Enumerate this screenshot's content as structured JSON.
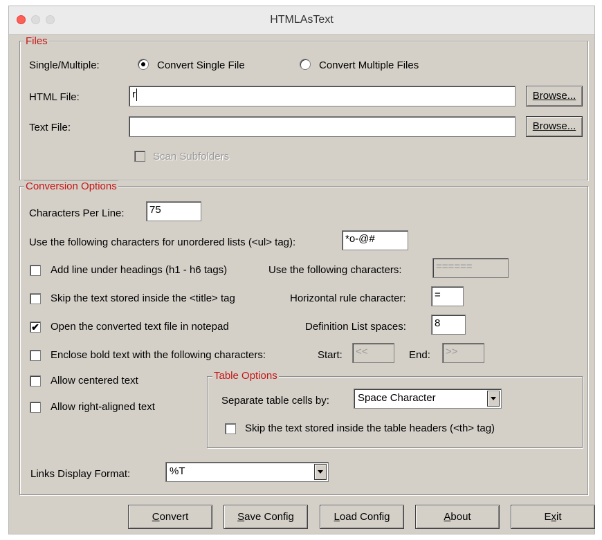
{
  "window": {
    "title": "HTMLAsText"
  },
  "files": {
    "legend": "Files",
    "mode_label": "Single/Multiple:",
    "radio_single": "Convert Single File",
    "radio_multiple": "Convert Multiple Files",
    "selected_mode": "single",
    "html_file_label": "HTML File:",
    "html_file_value": "r",
    "text_file_label": "Text File:",
    "text_file_value": "",
    "browse_label": "Browse...",
    "scan_subfolders": "Scan Subfolders"
  },
  "conversion": {
    "legend": "Conversion Options",
    "chars_per_line_label": "Characters Per Line:",
    "chars_per_line_value": "75",
    "ul_chars_label": "Use the following characters for unordered lists (<ul> tag):",
    "ul_chars_value": "*o-@#",
    "add_line_headings": "Add line under headings (h1 - h6 tags)",
    "add_line_headings_checked": false,
    "heading_chars_label": "Use the following characters:",
    "heading_chars_value": "======",
    "skip_title": "Skip the text stored inside the <title> tag",
    "skip_title_checked": false,
    "hr_char_label": "Horizontal rule character:",
    "hr_char_value": "=",
    "open_notepad": "Open the converted text file in notepad",
    "open_notepad_checked": true,
    "dl_spaces_label": "Definition List spaces:",
    "dl_spaces_value": "8",
    "enclose_bold": "Enclose bold text with the following characters:",
    "enclose_bold_checked": false,
    "start_label": "Start:",
    "start_value": "<<",
    "end_label": "End:",
    "end_value": ">>",
    "allow_centered": "Allow centered text",
    "allow_right": "Allow right-aligned text",
    "links_format_label": "Links Display Format:",
    "links_format_value": "%T"
  },
  "table": {
    "legend": "Table Options",
    "separate_label": "Separate table cells by:",
    "separate_value": "Space Character",
    "skip_th": "Skip the text stored inside the table headers (<th> tag)",
    "skip_th_checked": false
  },
  "buttons": {
    "convert": {
      "mn": "C",
      "rest": "onvert"
    },
    "save": {
      "mn": "S",
      "rest": "ave Config"
    },
    "load": {
      "mn": "L",
      "rest": "oad Config"
    },
    "about": {
      "mn": "A",
      "rest": "bout"
    },
    "exit": {
      "pre": "E",
      "mn": "x",
      "rest": "it"
    }
  },
  "colors": {
    "legend_red": "#c41616",
    "dialog_bg": "#d4d0c8",
    "close_red": "#fe5f57"
  }
}
